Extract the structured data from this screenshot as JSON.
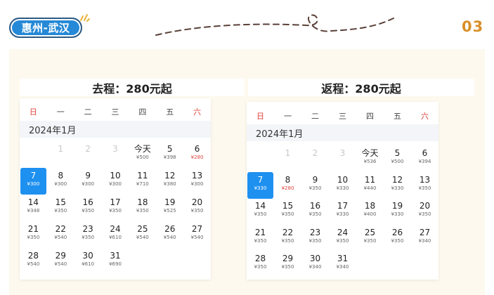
{
  "header": {
    "route": "惠州-武汉",
    "page_number": "03"
  },
  "colors": {
    "accent_blue": "#1e90f0",
    "pill_blue": "#2589d7",
    "price_red": "#e0443d",
    "page_number_orange": "#d8902a",
    "panel_cream": "#fdf9ee"
  },
  "outbound": {
    "title": "去程：280元起",
    "weekdays": [
      "日",
      "一",
      "二",
      "三",
      "四",
      "五",
      "六"
    ],
    "month": "2024年1月",
    "days": [
      {
        "d": "1",
        "p": "",
        "state": "disabled"
      },
      {
        "d": "2",
        "p": "",
        "state": "disabled"
      },
      {
        "d": "3",
        "p": "",
        "state": "disabled"
      },
      {
        "d": "今天",
        "p": "¥500"
      },
      {
        "d": "5",
        "p": "¥398"
      },
      {
        "d": "6",
        "p": "¥280",
        "red": true
      },
      {
        "d": "7",
        "p": "¥300",
        "state": "selected"
      },
      {
        "d": "8",
        "p": "¥300"
      },
      {
        "d": "9",
        "p": "¥300"
      },
      {
        "d": "10",
        "p": "¥300"
      },
      {
        "d": "11",
        "p": "¥710"
      },
      {
        "d": "12",
        "p": "¥380"
      },
      {
        "d": "13",
        "p": "¥300"
      },
      {
        "d": "14",
        "p": "¥348"
      },
      {
        "d": "15",
        "p": "¥350"
      },
      {
        "d": "16",
        "p": "¥350"
      },
      {
        "d": "17",
        "p": "¥350"
      },
      {
        "d": "18",
        "p": "¥350"
      },
      {
        "d": "19",
        "p": "¥525"
      },
      {
        "d": "20",
        "p": "¥350"
      },
      {
        "d": "21",
        "p": "¥350"
      },
      {
        "d": "22",
        "p": "¥540"
      },
      {
        "d": "23",
        "p": "¥350"
      },
      {
        "d": "24",
        "p": "¥610"
      },
      {
        "d": "25",
        "p": "¥540"
      },
      {
        "d": "26",
        "p": "¥540"
      },
      {
        "d": "27",
        "p": "¥540"
      },
      {
        "d": "28",
        "p": "¥540"
      },
      {
        "d": "29",
        "p": "¥540"
      },
      {
        "d": "30",
        "p": "¥610"
      },
      {
        "d": "31",
        "p": "¥690"
      }
    ]
  },
  "return": {
    "title": "返程：280元起",
    "weekdays": [
      "日",
      "一",
      "二",
      "三",
      "四",
      "五",
      "六"
    ],
    "month": "2024年1月",
    "days": [
      {
        "d": "1",
        "p": "",
        "state": "disabled"
      },
      {
        "d": "2",
        "p": "",
        "state": "disabled"
      },
      {
        "d": "3",
        "p": "",
        "state": "disabled"
      },
      {
        "d": "今天",
        "p": "¥536"
      },
      {
        "d": "5",
        "p": "¥500"
      },
      {
        "d": "6",
        "p": "¥394"
      },
      {
        "d": "7",
        "p": "¥330",
        "state": "selected"
      },
      {
        "d": "8",
        "p": "¥280",
        "red": true
      },
      {
        "d": "9",
        "p": "¥350"
      },
      {
        "d": "10",
        "p": "¥330"
      },
      {
        "d": "11",
        "p": "¥440"
      },
      {
        "d": "12",
        "p": "¥330"
      },
      {
        "d": "13",
        "p": "¥350"
      },
      {
        "d": "14",
        "p": "¥350"
      },
      {
        "d": "15",
        "p": "¥350"
      },
      {
        "d": "16",
        "p": "¥350"
      },
      {
        "d": "17",
        "p": "¥330"
      },
      {
        "d": "18",
        "p": "¥400"
      },
      {
        "d": "19",
        "p": "¥330"
      },
      {
        "d": "20",
        "p": "¥350"
      },
      {
        "d": "21",
        "p": "¥350"
      },
      {
        "d": "22",
        "p": "¥350"
      },
      {
        "d": "23",
        "p": "¥350"
      },
      {
        "d": "24",
        "p": "¥350"
      },
      {
        "d": "25",
        "p": "¥350"
      },
      {
        "d": "26",
        "p": "¥350"
      },
      {
        "d": "27",
        "p": "¥340"
      },
      {
        "d": "28",
        "p": "¥350"
      },
      {
        "d": "29",
        "p": "¥350"
      },
      {
        "d": "30",
        "p": "¥340"
      },
      {
        "d": "31",
        "p": "¥340"
      }
    ]
  }
}
